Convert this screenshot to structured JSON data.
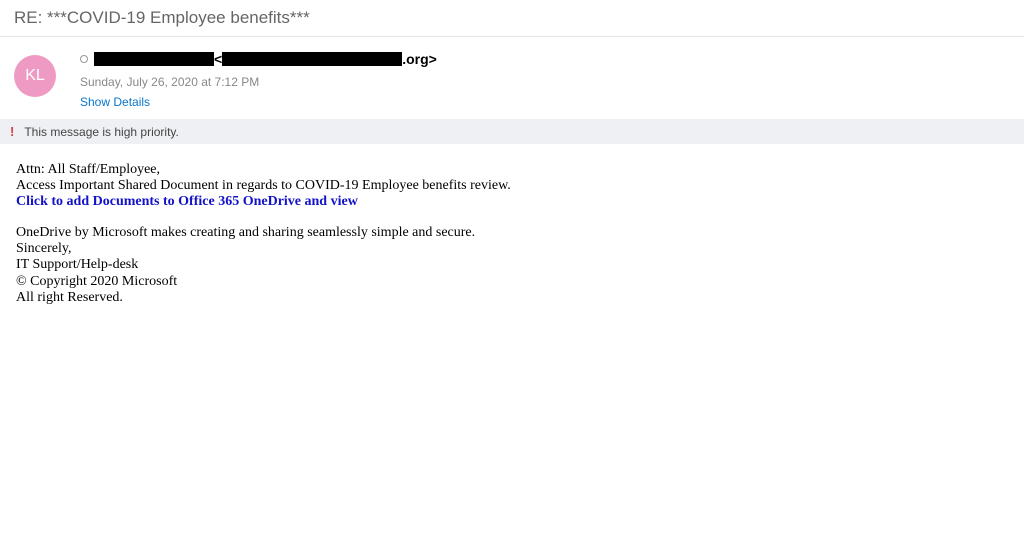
{
  "subject": "RE: ***COVID-19 Employee benefits***",
  "avatar_initials": "KL",
  "sender": {
    "name_redacted": true,
    "email_redacted_prefix": true,
    "email_suffix": ".org>",
    "bracket_open": " <"
  },
  "date": "Sunday, July 26, 2020 at 7:12 PM",
  "show_details_label": "Show Details",
  "priority_icon": "!",
  "priority_text": "This message is high priority.",
  "body": {
    "greeting": "Attn: All Staff/Employee,",
    "line1": "Access Important Shared Document in regards to COVID-19 Employee benefits review.",
    "link_text": "Click to add Documents to Office 365 OneDrive and view",
    "line2": "OneDrive by Microsoft makes creating and sharing seamlessly simple and secure.",
    "sig1": "Sincerely,",
    "sig2": "IT Support/Help-desk",
    "sig3": "© Copyright 2020 Microsoft",
    "sig4": "All right Reserved."
  }
}
